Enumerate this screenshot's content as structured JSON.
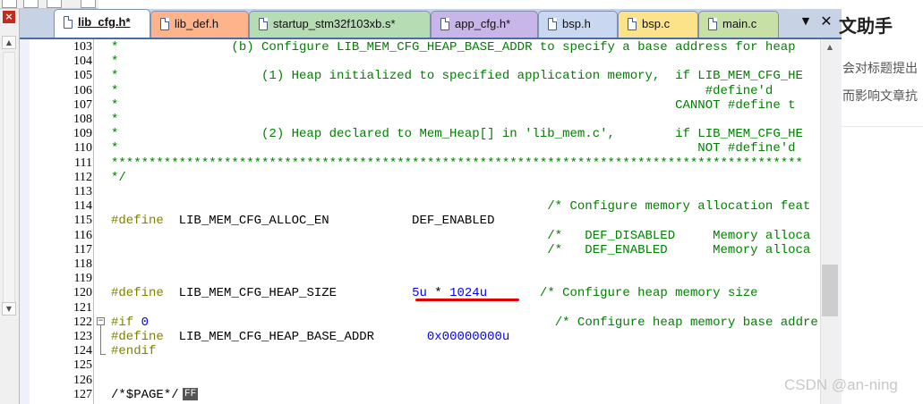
{
  "window": {
    "close_glyph": "×",
    "tab_menu_glyph": "▼",
    "tab_close_glyph": "✕"
  },
  "tabs": [
    {
      "label": "lib_cfg.h*",
      "active": true,
      "color": "#ffffff"
    },
    {
      "label": "lib_def.h",
      "active": false,
      "color": "#ffb38a"
    },
    {
      "label": "startup_stm32f103xb.s*",
      "active": false,
      "color": "#b6dcb4"
    },
    {
      "label": "app_cfg.h*",
      "active": false,
      "color": "#c8b6e8"
    },
    {
      "label": "bsp.h",
      "active": false,
      "color": "#c9d7f0"
    },
    {
      "label": "bsp.c",
      "active": false,
      "color": "#fce38a"
    },
    {
      "label": "main.c",
      "active": false,
      "color": "#c6e0a6"
    }
  ],
  "editor": {
    "lines": [
      {
        "n": "103",
        "segs": [
          [
            "cm",
            "*               (b) Configure LIB_MEM_CFG_HEAP_BASE_ADDR to specify a base address for heap"
          ]
        ]
      },
      {
        "n": "104",
        "segs": [
          [
            "cm",
            "*"
          ]
        ]
      },
      {
        "n": "105",
        "segs": [
          [
            "cm",
            "*                   (1) Heap initialized to specified application memory,  if LIB_MEM_CFG_HE"
          ]
        ]
      },
      {
        "n": "106",
        "segs": [
          [
            "cm",
            "*                                                                              #define'd"
          ]
        ]
      },
      {
        "n": "107",
        "segs": [
          [
            "cm",
            "*                                                                          CANNOT #define t"
          ]
        ]
      },
      {
        "n": "108",
        "segs": [
          [
            "cm",
            "*"
          ]
        ]
      },
      {
        "n": "109",
        "segs": [
          [
            "cm",
            "*                   (2) Heap declared to Mem_Heap[] in 'lib_mem.c',        if LIB_MEM_CFG_HE"
          ]
        ]
      },
      {
        "n": "110",
        "segs": [
          [
            "cm",
            "*                                                                             NOT #define'd"
          ]
        ]
      },
      {
        "n": "111",
        "segs": [
          [
            "cm",
            "********************************************************************************************"
          ]
        ]
      },
      {
        "n": "112",
        "segs": [
          [
            "cm",
            "*/"
          ]
        ]
      },
      {
        "n": "113",
        "segs": [
          [
            "",
            ""
          ]
        ]
      },
      {
        "n": "114",
        "segs": [
          [
            "",
            "                                                          "
          ],
          [
            "cm",
            "/* Configure memory allocation feat"
          ]
        ]
      },
      {
        "n": "115",
        "segs": [
          [
            "kw",
            "#define"
          ],
          [
            "",
            "  LIB_MEM_CFG_ALLOC_EN           DEF_ENABLED"
          ]
        ]
      },
      {
        "n": "116",
        "segs": [
          [
            "",
            "                                                          "
          ],
          [
            "cm",
            "/*   DEF_DISABLED     Memory alloca"
          ]
        ]
      },
      {
        "n": "117",
        "segs": [
          [
            "",
            "                                                          "
          ],
          [
            "cm",
            "/*   DEF_ENABLED      Memory alloca"
          ]
        ]
      },
      {
        "n": "118",
        "segs": [
          [
            "",
            ""
          ]
        ]
      },
      {
        "n": "119",
        "segs": [
          [
            "",
            ""
          ]
        ]
      },
      {
        "n": "120",
        "segs": [
          [
            "kw",
            "#define"
          ],
          [
            "",
            "  LIB_MEM_CFG_HEAP_SIZE          "
          ],
          [
            "num",
            "5u"
          ],
          [
            "",
            " * "
          ],
          [
            "num",
            "1024u"
          ],
          [
            "",
            "       "
          ],
          [
            "cm",
            "/* Configure heap memory size"
          ]
        ]
      },
      {
        "n": "121",
        "segs": [
          [
            "",
            ""
          ]
        ]
      },
      {
        "n": "122",
        "segs": [
          [
            "kw",
            "#if"
          ],
          [
            "",
            " "
          ],
          [
            "num",
            "0"
          ],
          [
            "",
            "                                                      "
          ],
          [
            "cm",
            "/* Configure heap memory base addre"
          ]
        ]
      },
      {
        "n": "123",
        "segs": [
          [
            "kw",
            "#define"
          ],
          [
            "",
            "  LIB_MEM_CFG_HEAP_BASE_ADDR       "
          ],
          [
            "num",
            "0x00000000u"
          ]
        ]
      },
      {
        "n": "124",
        "segs": [
          [
            "kw",
            "#endif"
          ]
        ]
      },
      {
        "n": "125",
        "segs": [
          [
            "",
            ""
          ]
        ]
      },
      {
        "n": "126",
        "segs": [
          [
            "",
            ""
          ]
        ]
      },
      {
        "n": "127",
        "segs": [
          [
            "",
            "/*$PAGE*/"
          ]
        ]
      }
    ],
    "ff_badge": "FF",
    "fold_glyph": "−"
  },
  "webpage": {
    "title": "文助手",
    "line1": "会对标题提出",
    "line2": "而影响文章抗"
  },
  "watermark": "CSDN @an-ning",
  "colors": {
    "comment": "#008000",
    "keyword": "#808000",
    "number": "#0000ff",
    "annotation": "#e00000",
    "tab_bar": "#c7d2e5"
  }
}
